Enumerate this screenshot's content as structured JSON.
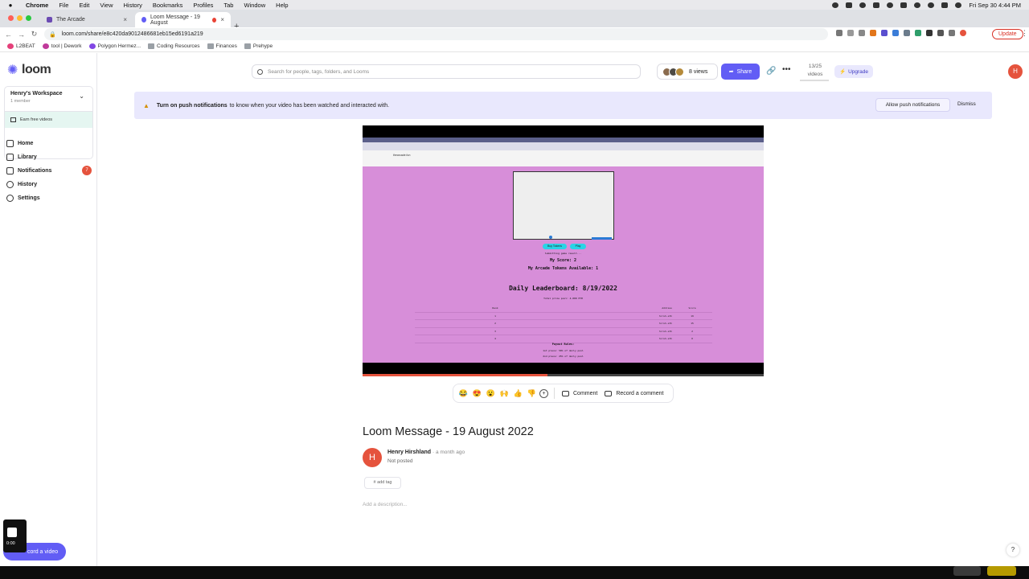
{
  "menubar": {
    "app": "Chrome",
    "items": [
      "File",
      "Edit",
      "View",
      "History",
      "Bookmarks",
      "Profiles",
      "Tab",
      "Window",
      "Help"
    ],
    "clock": "Fri Sep 30  4:44 PM"
  },
  "tabs": [
    {
      "title": "The Arcade",
      "active": false
    },
    {
      "title": "Loom Message - 19 August",
      "active": true
    }
  ],
  "address": {
    "url": "loom.com/share/e8c420da9012486681eb15ed6191a219",
    "update_label": "Update"
  },
  "bookmarks": [
    "L2BEAT",
    "tool | Dework",
    "Polygon Hermez...",
    "Coding Resources",
    "Finances",
    "Prehype"
  ],
  "sidebar": {
    "logo": "loom",
    "workspace_name": "Henry's Workspace",
    "workspace_members": "1 member",
    "earn": "Earn free videos",
    "nav": [
      {
        "label": "Home",
        "icon": "home-icon"
      },
      {
        "label": "Library",
        "icon": "library-icon"
      },
      {
        "label": "Notifications",
        "icon": "bell-icon",
        "badge": "7"
      },
      {
        "label": "History",
        "icon": "clock-icon"
      },
      {
        "label": "Settings",
        "icon": "gear-icon"
      }
    ],
    "record_timer": "0:00",
    "record_label": "cord a video"
  },
  "header": {
    "search_placeholder": "Search for people, tags, folders, and Looms",
    "views": "8 views",
    "share": "Share",
    "quota_count": "13/25",
    "quota_unit": "videos",
    "upgrade": "Upgrade",
    "avatar": "H"
  },
  "banner": {
    "bold": "Turn on push notifications",
    "text": "to know when your video has been watched and interacted with.",
    "allow": "Allow push notifications",
    "dismiss": "Dismiss"
  },
  "video": {
    "inner_url": "thearcade.fun",
    "buttons": [
      "Buy Tokens",
      "Play"
    ],
    "status": "Submitting game result...",
    "score": "My Score: 2",
    "tokens": "My Arcade Tokens Available: 1",
    "leaderboard_title": "Daily Leaderboard: 8/19/2022",
    "prize_pool": "Total prize pool: 4.000 ETH",
    "table_headers": [
      "Rank",
      "Address",
      "Score"
    ],
    "table_rows": [
      [
        "1",
        "hirsh.eth",
        "19"
      ],
      [
        "2",
        "hirsh.eth",
        "15"
      ],
      [
        "3",
        "hirsh.eth",
        "2"
      ],
      [
        "4",
        "hirsh.eth",
        "0"
      ]
    ],
    "payout_title": "Payout Rules:",
    "payout_1": "1st place: 50% of daily pool",
    "payout_2": "2nd place: 25% of daily pool",
    "progress": 0.46
  },
  "reactions": {
    "emojis": [
      "😂",
      "😍",
      "😮",
      "🙌",
      "👍",
      "👎"
    ],
    "comment": "Comment",
    "record_comment": "Record a comment"
  },
  "meta": {
    "title": "Loom Message - 19 August 2022",
    "author_initial": "H",
    "author": "Henry Hirshland",
    "time": "· a month ago",
    "status": "Not posted",
    "tag": "# add tag",
    "description_placeholder": "Add a description..."
  },
  "help": "?",
  "colors": {
    "brand": "#625df5",
    "avatar": "#e5533d",
    "banner": "#e9e8fd",
    "video_bg": "#d78ed9"
  }
}
